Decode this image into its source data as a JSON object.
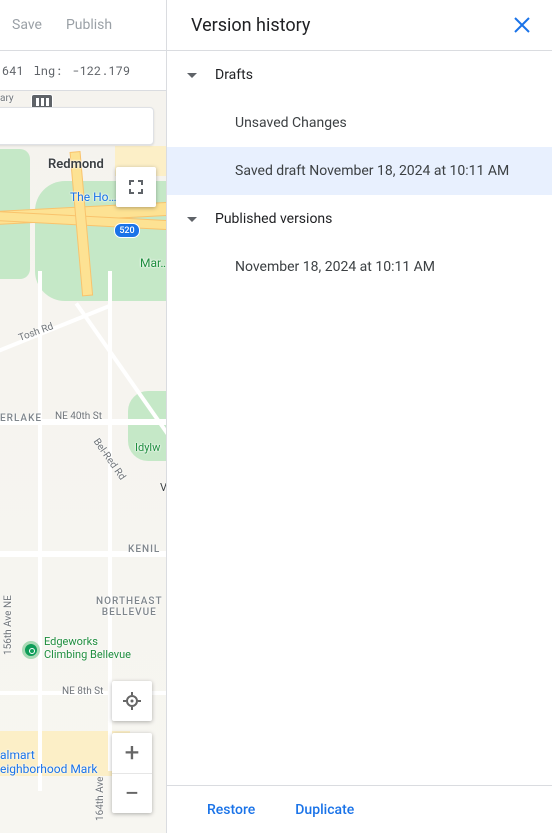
{
  "toolbar": {
    "save": "Save",
    "publish": "Publish"
  },
  "coords": {
    "lat_value": "641",
    "lng_label": "lng:",
    "lng_value": "-122.179"
  },
  "map": {
    "redmond": "Redmond",
    "home_depot": "The Ho…  ep…",
    "marymoor": "Mar…",
    "tosh": "Tosh Rd",
    "belred": "Bel-Red Rd",
    "ne40": "NE 40th St",
    "overlake": "ERLAKE",
    "idylwood": "Idylw",
    "vuecrest": "V",
    "kenilworth": "KENIL",
    "ne_bellevue": "NORTHEAST\nBELLEVUE",
    "library": "ary",
    "edgeworks": "Edgeworks\nClimbing Bellevue",
    "ne8th": "NE 8th St",
    "walmart": "almart\neighborhood Mark",
    "shield520": "520",
    "ave164": "164th Ave",
    "ave156": "156th Ave NE"
  },
  "panel": {
    "title": "Version history",
    "sections": {
      "drafts": {
        "label": "Drafts",
        "items": [
          {
            "label": "Unsaved Changes",
            "selected": false
          },
          {
            "label": "Saved draft November 18, 2024 at 10:11 AM",
            "selected": true
          }
        ]
      },
      "published": {
        "label": "Published versions",
        "items": [
          {
            "label": "November 18, 2024 at 10:11 AM",
            "selected": false
          }
        ]
      }
    },
    "footer": {
      "restore": "Restore",
      "duplicate": "Duplicate"
    }
  }
}
